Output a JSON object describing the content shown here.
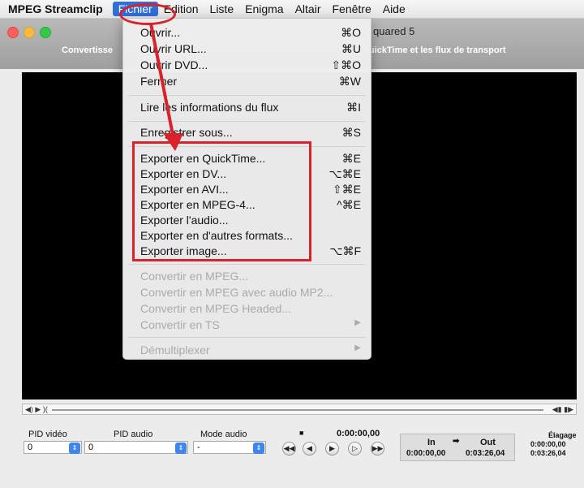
{
  "menubar": {
    "app": "MPEG Streamclip",
    "items": [
      "Fichier",
      "Edition",
      "Liste",
      "Enigma",
      "Altair",
      "Fenêtre",
      "Aide"
    ]
  },
  "window": {
    "title": "quared 5",
    "subtitle_left": "Convertisse",
    "subtitle_right": "uickTime et les flux de transport"
  },
  "menu": {
    "items": [
      {
        "label": "Ouvrir...",
        "shortcut": "⌘O",
        "enabled": true
      },
      {
        "label": "Ouvrir URL...",
        "shortcut": "⌘U",
        "enabled": true
      },
      {
        "label": "Ouvrir DVD...",
        "shortcut": "⇧⌘O",
        "enabled": true
      },
      {
        "label": "Fermer",
        "shortcut": "⌘W",
        "enabled": true
      },
      {
        "label": "Lire les informations du flux",
        "shortcut": "⌘I",
        "enabled": true
      },
      {
        "label": "Enregistrer sous...",
        "shortcut": "⌘S",
        "enabled": true
      },
      {
        "label": "Exporter en QuickTime...",
        "shortcut": "⌘E",
        "enabled": true
      },
      {
        "label": "Exporter en DV...",
        "shortcut": "⌥⌘E",
        "enabled": true
      },
      {
        "label": "Exporter en AVI...",
        "shortcut": "⇧⌘E",
        "enabled": true
      },
      {
        "label": "Exporter en MPEG-4...",
        "shortcut": "^⌘E",
        "enabled": true
      },
      {
        "label": "Exporter l'audio...",
        "shortcut": "",
        "enabled": true
      },
      {
        "label": "Exporter en d'autres formats...",
        "shortcut": "",
        "enabled": true
      },
      {
        "label": "Exporter image...",
        "shortcut": "⌥⌘F",
        "enabled": true
      },
      {
        "label": "Convertir en MPEG...",
        "shortcut": "",
        "enabled": false
      },
      {
        "label": "Convertir en MPEG avec audio MP2...",
        "shortcut": "",
        "enabled": false
      },
      {
        "label": "Convertir en MPEG Headed...",
        "shortcut": "",
        "enabled": false
      },
      {
        "label": "Convertir en TS",
        "shortcut": "▶",
        "enabled": false
      },
      {
        "label": "Démultiplexer",
        "shortcut": "▶",
        "enabled": false
      }
    ]
  },
  "controls": {
    "pid_video_label": "PID vidéo",
    "pid_video_value": "0",
    "pid_audio_label": "PID audio",
    "pid_audio_value": "0",
    "mode_audio_label": "Mode audio",
    "mode_audio_value": "-",
    "current_time": "0:00:00,00",
    "in_label": "In",
    "out_label": "Out",
    "in_time": "0:00:00,00",
    "out_time": "0:03:26,04",
    "elagage_label": "Élagage",
    "elagage_start": "0:00:00,00",
    "elagage_end": "0:03:26,04"
  },
  "colors": {
    "accent": "#2f6fd8",
    "annotation": "#d8232a"
  }
}
